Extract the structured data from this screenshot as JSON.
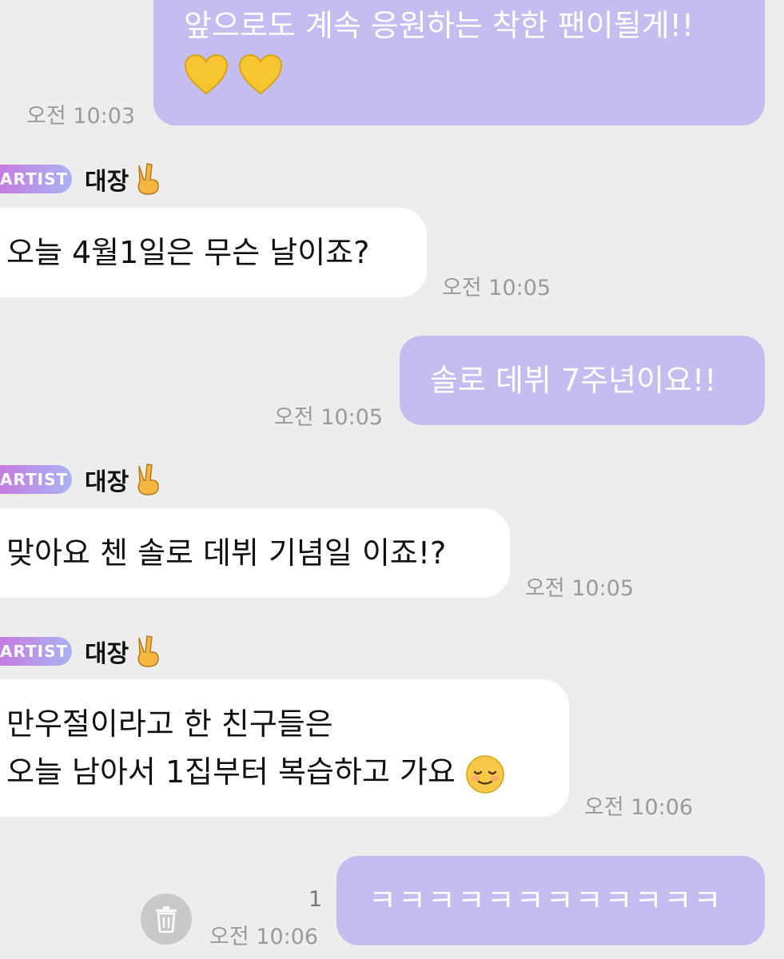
{
  "messages": {
    "m1": {
      "text": "앞으로도 계속 응원하는 착한 팬이될게!!",
      "emoji": "yellow-heart-icon x2",
      "time": "오전 10:03"
    },
    "sender1": {
      "badge": "ARTIST",
      "name": "대장",
      "emoji": "victory-hand-icon"
    },
    "m2": {
      "text": "오늘 4월1일은 무슨 날이죠?",
      "time": "오전 10:05"
    },
    "m3": {
      "text": "솔로 데뷔 7주년이요!!",
      "time": "오전 10:05"
    },
    "sender2": {
      "badge": "ARTIST",
      "name": "대장",
      "emoji": "victory-hand-icon"
    },
    "m4": {
      "text": "맞아요 첸 솔로 데뷔 기념일 이죠!?",
      "time": "오전 10:05"
    },
    "sender3": {
      "badge": "ARTIST",
      "name": "대장",
      "emoji": "victory-hand-icon"
    },
    "m5": {
      "line1": "만우절이라고 한 친구들은",
      "line2": "오늘 남아서 1집부터 복습하고 가요",
      "emoji": "relieved-face-icon",
      "time": "오전 10:06"
    },
    "m6": {
      "text": "ㅋㅋㅋㅋㅋㅋㅋㅋㅋㅋㅋㅋ",
      "unread": "1",
      "time": "오전 10:06",
      "action_icon": "trash-icon"
    }
  },
  "colors": {
    "background": "#ededed",
    "sent_bubble": "#c4bef0",
    "received_bubble": "#ffffff",
    "timestamp": "#9a9a9a",
    "badge_gradient_start": "#c67ce0",
    "badge_gradient_end": "#a9b2f2"
  }
}
